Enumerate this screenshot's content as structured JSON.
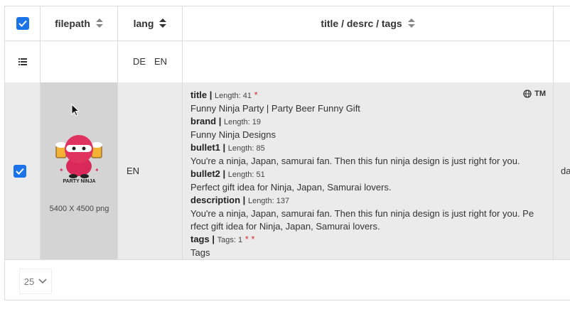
{
  "header": {
    "filepath_label": "filepath",
    "lang_label": "lang",
    "title_label": "title / desrc / tags"
  },
  "filter": {
    "lang_options": [
      "DE",
      "EN"
    ]
  },
  "row": {
    "image_brand_text": "PARTY NINJA",
    "dimensions": "5400 X 4500 png",
    "lang": "EN",
    "tm_label": "TM",
    "title_key": "title |",
    "title_length": "Length: 41",
    "title_value": "Funny Ninja Party | Party Beer Funny Gift",
    "brand_key": "brand |",
    "brand_length": "Length: 19",
    "brand_value": "Funny Ninja Designs",
    "bullet1_key": "bullet1 |",
    "bullet1_length": "Length: 85",
    "bullet1_value": "You're a ninja, Japan, samurai fan. Then this fun ninja design is just right for you.",
    "bullet2_key": "bullet2 |",
    "bullet2_length": "Length: 51",
    "bullet2_value": "Perfect gift idea for Ninja, Japan, Samurai lovers.",
    "description_key": "description |",
    "description_length": "Length: 137",
    "description_value_line1": "You're a ninja, Japan, samurai fan. Then this fun ninja design is just right for you. Pe",
    "description_value_line2": "rfect gift idea for Ninja, Japan, Samurai lovers.",
    "tags_key": "tags |",
    "tags_count": "Tags: 1",
    "tags_value": "Tags",
    "next_col_partial": "da"
  },
  "footer": {
    "page_size": "25"
  },
  "colors": {
    "accent": "#1a73e8",
    "required_star": "#d32f2f"
  }
}
